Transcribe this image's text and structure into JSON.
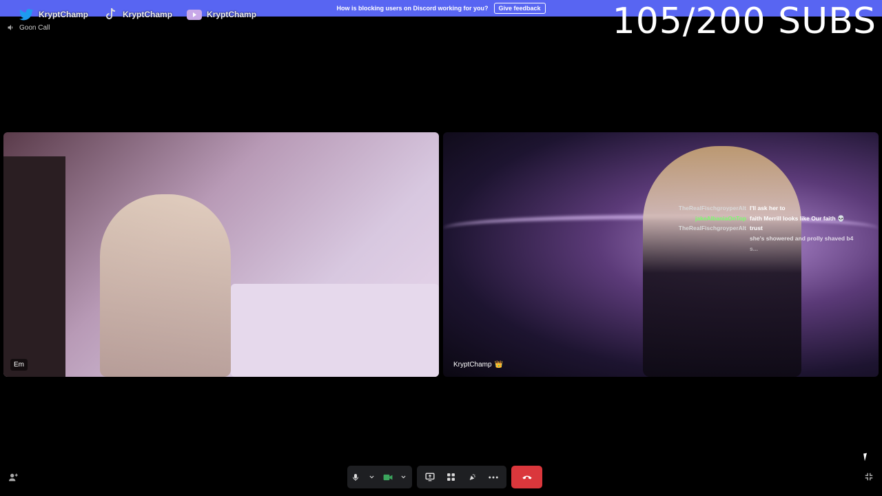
{
  "banner": {
    "message": "How is blocking users on Discord working for you?",
    "feedback_label": "Give feedback"
  },
  "socials": [
    {
      "platform": "twitter-icon",
      "handle": "KryptChamp"
    },
    {
      "platform": "tiktok-icon",
      "handle": "KryptChamp"
    },
    {
      "platform": "youtube-icon",
      "handle": "KryptChamp"
    }
  ],
  "overlay": {
    "subs": "105/200 SUBS"
  },
  "channel": {
    "name": "Goon Call"
  },
  "tiles": [
    {
      "name": "Em"
    },
    {
      "name": "KryptChamp",
      "badge": "👑"
    }
  ],
  "chat": [
    {
      "user": "TheRealFischgroyperAlt",
      "color": "#d9d9d9",
      "text": "I'll ask her to"
    },
    {
      "user": "jakeAlbaniaOnTop",
      "color": "#7cfc6e",
      "text": "faith Merrill looks like Our faith 💀"
    },
    {
      "user": "TheRealFischgroyperAlt",
      "color": "#d9d9d9",
      "text": "trust"
    },
    {
      "user": "",
      "color": "#c04a4a",
      "text": "she's showered and prolly shaved b4"
    },
    {
      "user": "",
      "color": "#c04a4a",
      "text": "s..."
    }
  ],
  "colors": {
    "banner": "#5865f2",
    "hangup": "#da373c",
    "control_bg": "#1e1f22",
    "camera_on": "#3ba55d"
  }
}
